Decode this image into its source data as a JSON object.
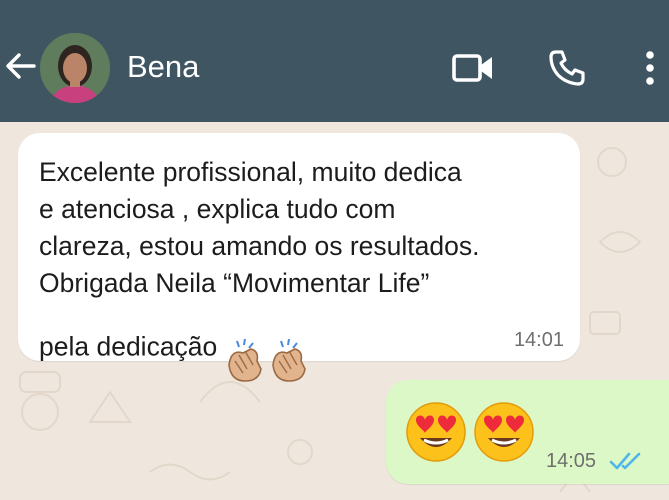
{
  "header": {
    "contact_name": "Bena",
    "icons": [
      "back-arrow-icon",
      "video-call-icon",
      "phone-icon",
      "more-vert-icon"
    ],
    "background": "#3f5562"
  },
  "messages": {
    "incoming": {
      "text": "Excelente profissional, muito dedica\ne atenciosa , explica tudo com\nclareza, estou amando os resultados.\nObrigada Neila “Movimentar Life”\npela dedicação",
      "emoji": "👏🏼👏🏼",
      "time": "14:01"
    },
    "outgoing": {
      "emoji": "😍😍",
      "time": "14:05",
      "status": "read",
      "tick_color": "#4fb6ec"
    }
  },
  "colors": {
    "incoming_bubble": "#ffffff",
    "outgoing_bubble": "#dcf8c6",
    "chat_background": "#efe7dd"
  }
}
